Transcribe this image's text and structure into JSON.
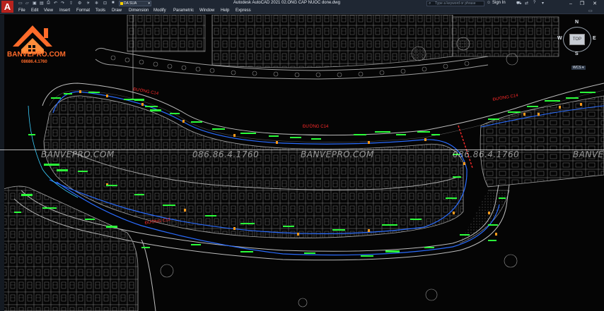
{
  "titlebar": {
    "app_logo": "A",
    "layer_name": "DA SUA",
    "window_title": "Autodesk AutoCAD 2021   02.ONG CAP NUOC done.dwg",
    "search_placeholder": "Type a keyword or phrase",
    "sign_in": "Sign In",
    "controls": {
      "minimize": "–",
      "maximize": "❐",
      "close": "✕"
    }
  },
  "menu": [
    "File",
    "Edit",
    "View",
    "Insert",
    "Format",
    "Tools",
    "Draw",
    "Dimension",
    "Modify",
    "Parametric",
    "Window",
    "Help",
    "Express"
  ],
  "watermark": {
    "brand": "BANVEPRO.COM",
    "phone_short": "08686.4.1760",
    "banner_site": "BANVEPRO.COM",
    "banner_phone": "086.86.4.1760"
  },
  "viewcube": {
    "top": "TOP",
    "n": "N",
    "w": "W",
    "e": "E",
    "s": "S",
    "wcs": "WCS ▾"
  },
  "drawing": {
    "road_labels": [
      "ĐƯỜNG C14",
      "ĐƯỜNG C14",
      "ĐƯỜNG C14",
      "ĐƯỜNG C13"
    ],
    "accent_colors": {
      "pipe_green": "#2bff3a",
      "road_label_red": "#ff2a2a",
      "pipe_orange": "#ff9a1a",
      "lot_gray": "#9a9a9a",
      "pipe_blue": "#2a6cff",
      "cyan": "#3ad0ff"
    }
  }
}
